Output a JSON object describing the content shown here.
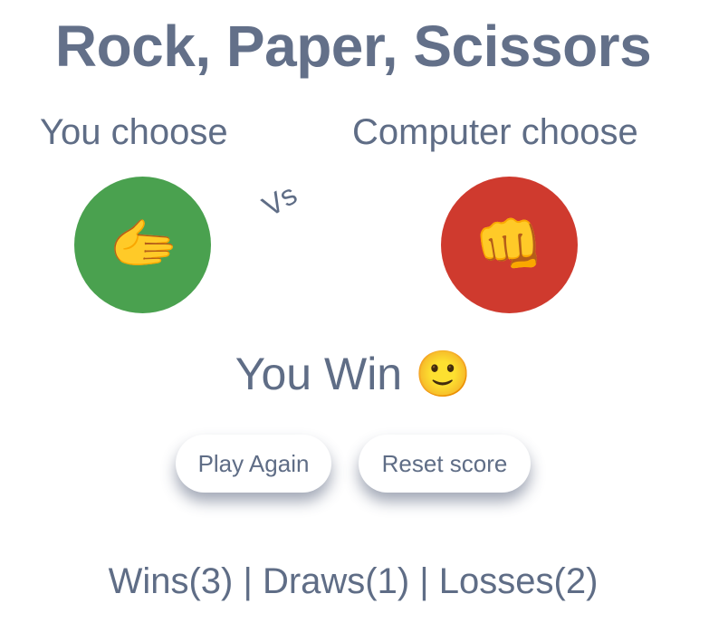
{
  "title": "Rock, Paper, Scissors",
  "player": {
    "label": "You choose",
    "choice_icon": "✋",
    "choice_icon_name": "paper-hand-icon",
    "color": "#4aa14f"
  },
  "computer": {
    "label": "Computer choose",
    "choice_icon": "👊",
    "choice_icon_name": "rock-fist-icon",
    "color": "#cf3a2e"
  },
  "vs_label": "Vs",
  "result": {
    "text": "You Win 🙂"
  },
  "buttons": {
    "play_again": "Play Again",
    "reset_score": "Reset score"
  },
  "score": {
    "text": "Wins(3) | Draws(1) | Losses(2)",
    "wins": 3,
    "draws": 1,
    "losses": 2
  }
}
